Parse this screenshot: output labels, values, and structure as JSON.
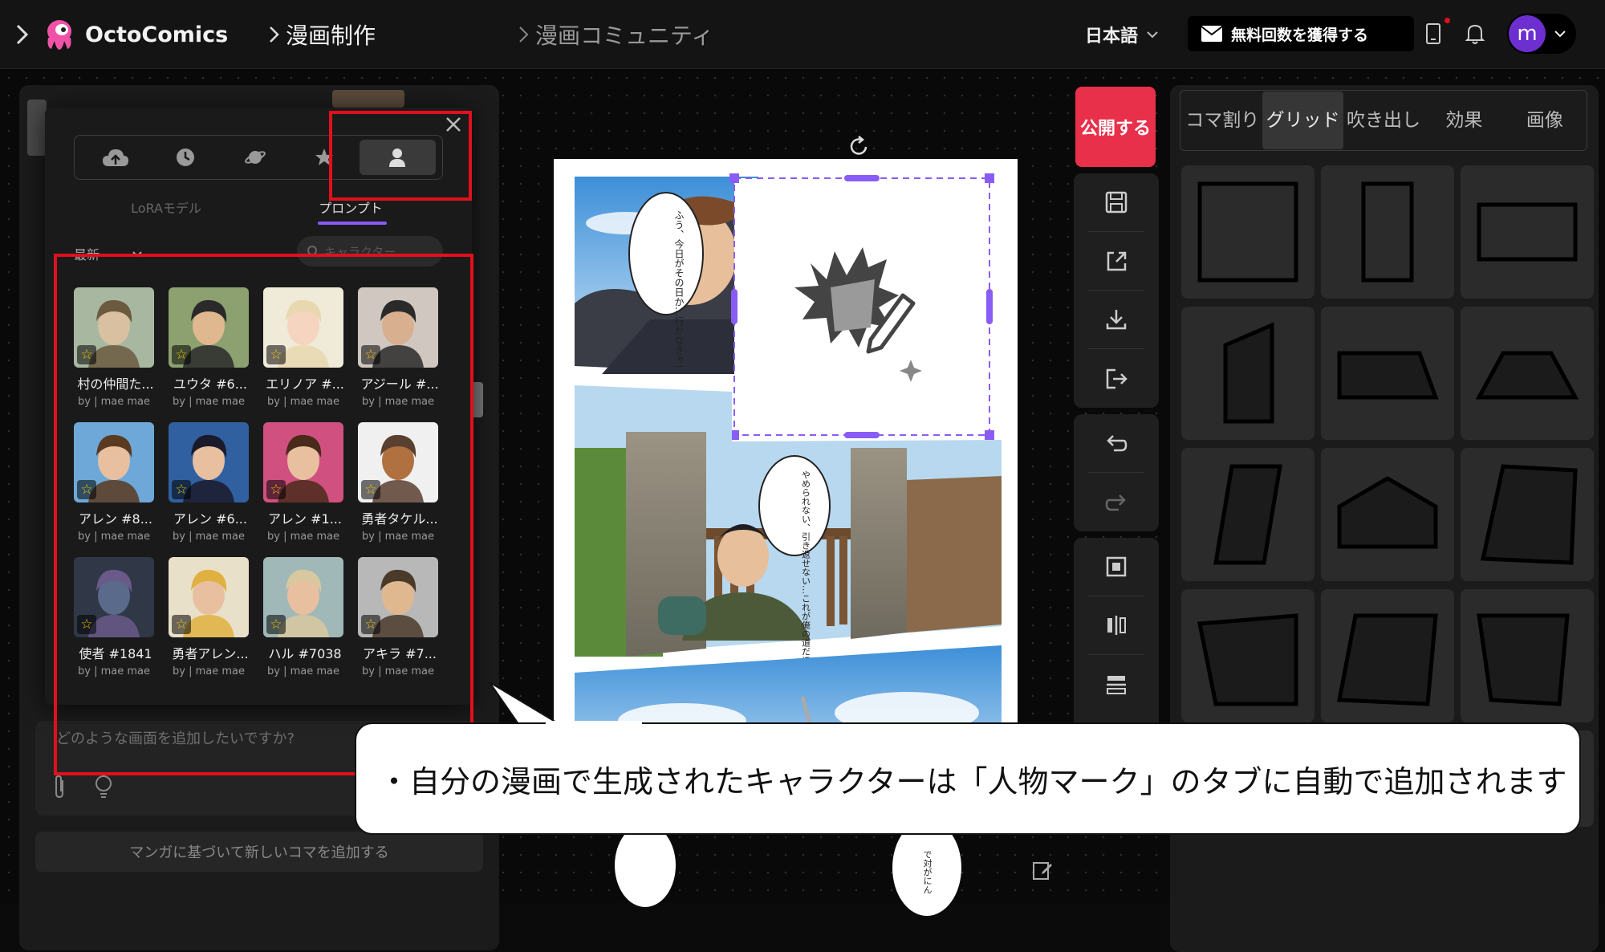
{
  "header": {
    "brand": "OctoComics",
    "nav_create": "漫画制作",
    "nav_community": "漫画コミュニティ",
    "language": "日本語",
    "cta": "無料回数を獲得する",
    "avatar_initial": "m"
  },
  "popup": {
    "tabs": [
      "LoRAモデル",
      "プロンプト"
    ],
    "sort_label": "最新",
    "search_placeholder": "キャラクター",
    "characters": [
      {
        "name": "村の仲間た...",
        "by": "by | mae mae"
      },
      {
        "name": "ユウタ #6...",
        "by": "by | mae mae"
      },
      {
        "name": "エリノア #...",
        "by": "by | mae mae"
      },
      {
        "name": "アジール #...",
        "by": "by | mae mae"
      },
      {
        "name": "アレン #8...",
        "by": "by | mae mae"
      },
      {
        "name": "アレン #6...",
        "by": "by | mae mae"
      },
      {
        "name": "アレン #1...",
        "by": "by | mae mae"
      },
      {
        "name": "勇者タケル...",
        "by": "by | mae mae"
      },
      {
        "name": "使者 #1841",
        "by": "by | mae mae"
      },
      {
        "name": "勇者アレン...",
        "by": "by | mae mae"
      },
      {
        "name": "ハル #7038",
        "by": "by | mae mae"
      },
      {
        "name": "アキラ #7...",
        "by": "by | mae mae"
      }
    ]
  },
  "prompt": {
    "placeholder": "どのような画面を追加したいですか?",
    "add_button": "マンガに基づいて新しいコマを追加する"
  },
  "canvas": {
    "bubble1": "ふう、今日がその日か…行かなきゃ!",
    "bubble2": "やめられない、引き返せない…これが俺の道だ!",
    "bubble3": "で対がにん"
  },
  "tools": {
    "publish": "公開する"
  },
  "right_tabs": [
    "コマ割り",
    "グリッド",
    "吹き出し",
    "効果",
    "画像"
  ],
  "callout": "・自分の漫画で生成されたキャラクターは「人物マーク」のタブに自動で追加されます",
  "colors": {
    "accent_red": "#e0101c",
    "brand_pink": "#f052a7",
    "publish": "#e8304a",
    "selection": "#8a5cf6"
  }
}
